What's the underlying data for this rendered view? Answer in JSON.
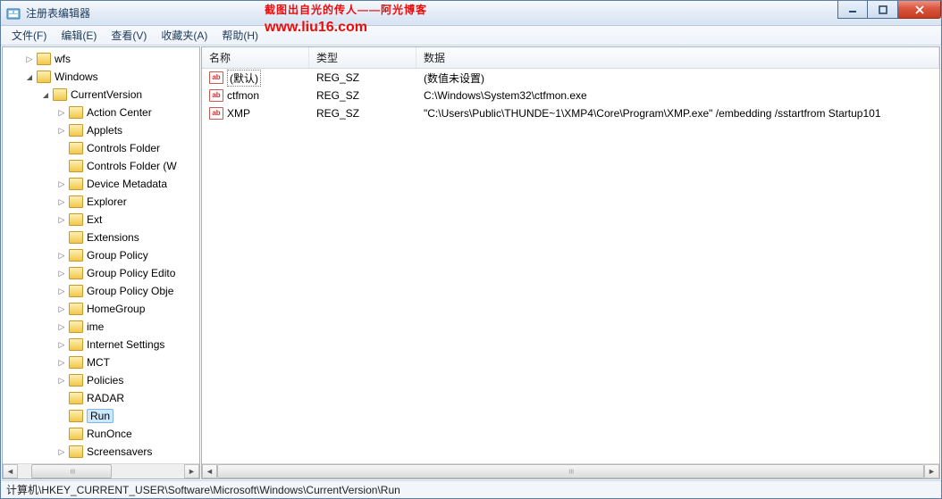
{
  "watermark": {
    "line1": "截图出自光的传人——阿光博客",
    "line2": "www.liu16.com"
  },
  "titlebar": {
    "title": "注册表编辑器"
  },
  "menu": {
    "file": "文件(F)",
    "edit": "编辑(E)",
    "view": "查看(V)",
    "favorites": "收藏夹(A)",
    "help": "帮助(H)"
  },
  "tree": {
    "items": [
      {
        "depth": 1,
        "state": "closed",
        "label": "wfs"
      },
      {
        "depth": 1,
        "state": "open",
        "label": "Windows"
      },
      {
        "depth": 2,
        "state": "open",
        "label": "CurrentVersion"
      },
      {
        "depth": 3,
        "state": "closed",
        "label": "Action Center"
      },
      {
        "depth": 3,
        "state": "closed",
        "label": "Applets"
      },
      {
        "depth": 3,
        "state": "none",
        "label": "Controls Folder"
      },
      {
        "depth": 3,
        "state": "none",
        "label": "Controls Folder (W"
      },
      {
        "depth": 3,
        "state": "closed",
        "label": "Device Metadata"
      },
      {
        "depth": 3,
        "state": "closed",
        "label": "Explorer"
      },
      {
        "depth": 3,
        "state": "closed",
        "label": "Ext"
      },
      {
        "depth": 3,
        "state": "none",
        "label": "Extensions"
      },
      {
        "depth": 3,
        "state": "closed",
        "label": "Group Policy"
      },
      {
        "depth": 3,
        "state": "closed",
        "label": "Group Policy Edito"
      },
      {
        "depth": 3,
        "state": "closed",
        "label": "Group Policy Obje"
      },
      {
        "depth": 3,
        "state": "closed",
        "label": "HomeGroup"
      },
      {
        "depth": 3,
        "state": "closed",
        "label": "ime"
      },
      {
        "depth": 3,
        "state": "closed",
        "label": "Internet Settings"
      },
      {
        "depth": 3,
        "state": "closed",
        "label": "MCT"
      },
      {
        "depth": 3,
        "state": "closed",
        "label": "Policies"
      },
      {
        "depth": 3,
        "state": "none",
        "label": "RADAR"
      },
      {
        "depth": 3,
        "state": "none",
        "label": "Run",
        "selected": true
      },
      {
        "depth": 3,
        "state": "none",
        "label": "RunOnce"
      },
      {
        "depth": 3,
        "state": "closed",
        "label": "Screensavers"
      }
    ]
  },
  "list": {
    "columns": {
      "name": "名称",
      "type": "类型",
      "data": "数据"
    },
    "colwidths": {
      "name": 120,
      "type": 120
    },
    "rows": [
      {
        "name": "(默认)",
        "type": "REG_SZ",
        "data": "(数值未设置)",
        "selected": true
      },
      {
        "name": "ctfmon",
        "type": "REG_SZ",
        "data": "C:\\Windows\\System32\\ctfmon.exe"
      },
      {
        "name": "XMP",
        "type": "REG_SZ",
        "data": "\"C:\\Users\\Public\\THUNDE~1\\XMP4\\Core\\Program\\XMP.exe\" /embedding /sstartfrom Startup101"
      }
    ]
  },
  "statusbar": {
    "path": "计算机\\HKEY_CURRENT_USER\\Software\\Microsoft\\Windows\\CurrentVersion\\Run"
  }
}
